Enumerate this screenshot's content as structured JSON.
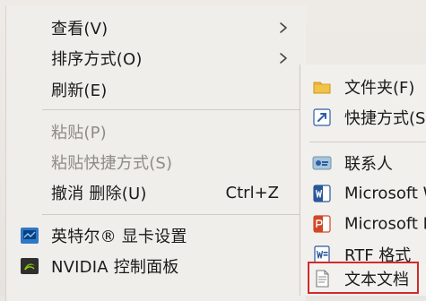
{
  "main_menu": {
    "items": [
      {
        "label": "查看(V)",
        "has_submenu": true
      },
      {
        "label": "排序方式(O)",
        "has_submenu": true
      },
      {
        "label": "刷新(E)"
      },
      {
        "label": "粘贴(P)",
        "disabled": true
      },
      {
        "label": "粘贴快捷方式(S)",
        "disabled": true
      },
      {
        "label": "撤消 删除(U)",
        "shortcut": "Ctrl+Z"
      },
      {
        "label": "英特尔® 显卡设置",
        "icon": "intel-graphics-icon"
      },
      {
        "label": "NVIDIA 控制面板",
        "icon": "nvidia-icon"
      }
    ]
  },
  "new_submenu": {
    "items": [
      {
        "label": "文件夹(F)",
        "icon": "folder-icon"
      },
      {
        "label": "快捷方式(S",
        "icon": "shortcut-icon"
      },
      {
        "label": "联系人",
        "icon": "contact-icon"
      },
      {
        "label": "Microsoft W",
        "icon": "word-icon"
      },
      {
        "label": "Microsoft P",
        "icon": "powerpoint-icon"
      },
      {
        "label": "RTF 格式",
        "icon": "rtf-icon"
      },
      {
        "label": "文本文档",
        "icon": "text-document-icon",
        "highlighted": true
      }
    ]
  },
  "colors": {
    "highlight_border": "#d02b2b",
    "menu_bg": "#f0eeeb",
    "submenu_bg": "#f2f0ed"
  }
}
